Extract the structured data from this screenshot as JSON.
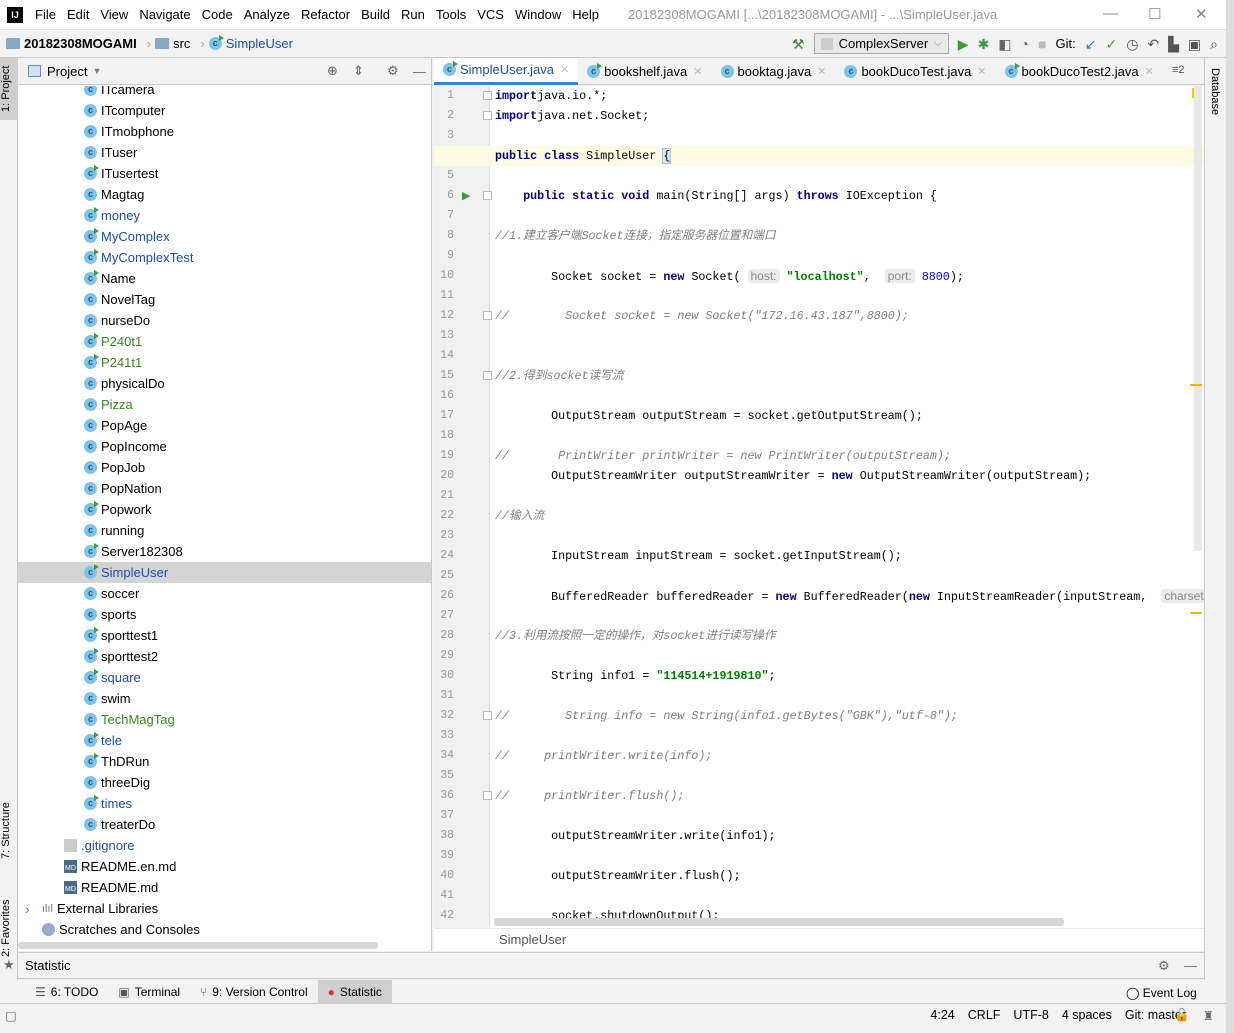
{
  "menubar": {
    "items": [
      "File",
      "Edit",
      "View",
      "Navigate",
      "Code",
      "Analyze",
      "Refactor",
      "Build",
      "Run",
      "Tools",
      "VCS",
      "Window",
      "Help"
    ],
    "window_title": "20182308MOGAMI [...\\20182308MOGAMI] - ...\\SimpleUser.java"
  },
  "navbar": {
    "crumbs": [
      "20182308MOGAMI",
      "src",
      "SimpleUser"
    ],
    "run_config": "ComplexServer",
    "git_label": "Git:"
  },
  "left_strip": {
    "project": "1: Project",
    "structure": "7: Structure",
    "favorites": "2: Favorites"
  },
  "right_strip": {
    "database": "Database"
  },
  "project": {
    "title": "Project",
    "tree": [
      {
        "label": "ITcamera",
        "kind": "class",
        "status": "",
        "run": false,
        "indent": 1
      },
      {
        "label": "ITcomputer",
        "kind": "class",
        "status": "",
        "run": false,
        "indent": 1
      },
      {
        "label": "ITmobphone",
        "kind": "class",
        "status": "",
        "run": false,
        "indent": 1
      },
      {
        "label": "ITuser",
        "kind": "class",
        "status": "",
        "run": false,
        "indent": 1
      },
      {
        "label": "ITusertest",
        "kind": "class",
        "status": "",
        "run": true,
        "indent": 1
      },
      {
        "label": "Magtag",
        "kind": "class",
        "status": "",
        "run": false,
        "indent": 1
      },
      {
        "label": "money",
        "kind": "class",
        "status": "mod",
        "run": true,
        "indent": 1
      },
      {
        "label": "MyComplex",
        "kind": "class",
        "status": "mod",
        "run": true,
        "indent": 1
      },
      {
        "label": "MyComplexTest",
        "kind": "class",
        "status": "mod",
        "run": true,
        "indent": 1
      },
      {
        "label": "Name",
        "kind": "class",
        "status": "",
        "run": true,
        "indent": 1
      },
      {
        "label": "NovelTag",
        "kind": "class",
        "status": "",
        "run": false,
        "indent": 1
      },
      {
        "label": "nurseDo",
        "kind": "class",
        "status": "",
        "run": false,
        "indent": 1
      },
      {
        "label": "P240t1",
        "kind": "class",
        "status": "new",
        "run": true,
        "indent": 1
      },
      {
        "label": "P241t1",
        "kind": "class",
        "status": "new",
        "run": true,
        "indent": 1
      },
      {
        "label": "physicalDo",
        "kind": "class",
        "status": "",
        "run": false,
        "indent": 1
      },
      {
        "label": "Pizza",
        "kind": "class",
        "status": "new",
        "run": false,
        "indent": 1
      },
      {
        "label": "PopAge",
        "kind": "class",
        "status": "",
        "run": false,
        "indent": 1
      },
      {
        "label": "PopIncome",
        "kind": "class",
        "status": "",
        "run": false,
        "indent": 1
      },
      {
        "label": "PopJob",
        "kind": "class",
        "status": "",
        "run": false,
        "indent": 1
      },
      {
        "label": "PopNation",
        "kind": "class",
        "status": "",
        "run": false,
        "indent": 1
      },
      {
        "label": "Popwork",
        "kind": "class",
        "status": "",
        "run": true,
        "indent": 1
      },
      {
        "label": "running",
        "kind": "class",
        "status": "",
        "run": false,
        "indent": 1
      },
      {
        "label": "Server182308",
        "kind": "class",
        "status": "",
        "run": true,
        "indent": 1
      },
      {
        "label": "SimpleUser",
        "kind": "class",
        "status": "mod",
        "run": true,
        "indent": 1,
        "selected": true
      },
      {
        "label": "soccer",
        "kind": "class",
        "status": "",
        "run": false,
        "indent": 1
      },
      {
        "label": "sports",
        "kind": "class",
        "status": "",
        "run": false,
        "indent": 1
      },
      {
        "label": "sporttest1",
        "kind": "class",
        "status": "",
        "run": true,
        "indent": 1
      },
      {
        "label": "sporttest2",
        "kind": "class",
        "status": "",
        "run": true,
        "indent": 1
      },
      {
        "label": "square",
        "kind": "class",
        "status": "mod",
        "run": true,
        "indent": 1
      },
      {
        "label": "swim",
        "kind": "class",
        "status": "",
        "run": false,
        "indent": 1
      },
      {
        "label": "TechMagTag",
        "kind": "class",
        "status": "new",
        "run": false,
        "indent": 1
      },
      {
        "label": "tele",
        "kind": "class",
        "status": "mod",
        "run": true,
        "indent": 1
      },
      {
        "label": "ThDRun",
        "kind": "class",
        "status": "",
        "run": true,
        "indent": 1
      },
      {
        "label": "threeDig",
        "kind": "class",
        "status": "",
        "run": false,
        "indent": 1
      },
      {
        "label": "times",
        "kind": "class",
        "status": "mod",
        "run": true,
        "indent": 1
      },
      {
        "label": "treaterDo",
        "kind": "class",
        "status": "",
        "run": false,
        "indent": 1
      },
      {
        "label": ".gitignore",
        "kind": "file",
        "status": "mod",
        "run": false,
        "indent": 0
      },
      {
        "label": "README.en.md",
        "kind": "md",
        "status": "",
        "run": false,
        "indent": 0
      },
      {
        "label": "README.md",
        "kind": "md",
        "status": "",
        "run": false,
        "indent": 0
      },
      {
        "label": "External Libraries",
        "kind": "lib",
        "status": "",
        "run": false,
        "indent": -1
      },
      {
        "label": "Scratches and Consoles",
        "kind": "scratch",
        "status": "",
        "run": false,
        "indent": -1
      }
    ]
  },
  "editor": {
    "tabs": [
      {
        "label": "SimpleUser.java",
        "active": true
      },
      {
        "label": "bookshelf.java"
      },
      {
        "label": "booktag.java"
      },
      {
        "label": "bookDucoTest.java"
      },
      {
        "label": "bookDucoTest2.java"
      }
    ],
    "tab_overflow": "≡2",
    "current_line": 4,
    "lines": [
      [
        [
          "kw",
          "import"
        ],
        [
          "",
          "java.io.*;"
        ]
      ],
      [
        [
          "kw",
          "import"
        ],
        [
          "",
          "java.net.Socket;"
        ]
      ],
      [],
      [
        [
          "kw",
          "public class"
        ],
        [
          "",
          " SimpleUser "
        ],
        [
          "brace",
          "{"
        ]
      ],
      [],
      [
        [
          "",
          "    "
        ],
        [
          "kw",
          "public static void"
        ],
        [
          "",
          " main(String[] args) "
        ],
        [
          "kw",
          "throws"
        ],
        [
          "",
          " IOException {"
        ]
      ],
      [],
      [
        [
          "cmt",
          "//1.建立客户端Socket连接，指定服务器位置和端口"
        ]
      ],
      [],
      [
        [
          "",
          "        Socket socket = "
        ],
        [
          "kw",
          "new"
        ],
        [
          "",
          " Socket( "
        ],
        [
          "hint",
          "host:"
        ],
        [
          "",
          " "
        ],
        [
          "str",
          "\"localhost\""
        ],
        [
          "",
          ",  "
        ],
        [
          "hint",
          "port:"
        ],
        [
          "",
          " "
        ],
        [
          "num",
          "8800"
        ],
        [
          "",
          ");"
        ]
      ],
      [],
      [
        [
          "cmt",
          "//        Socket socket = new Socket(\"172.16.43.187\",8800);"
        ]
      ],
      [],
      [],
      [
        [
          "cmt",
          "//2.得到socket读写流"
        ]
      ],
      [],
      [
        [
          "",
          "        OutputStream outputStream = socket.getOutputStream();"
        ]
      ],
      [],
      [
        [
          "cmt",
          "//       PrintWriter printWriter = new PrintWriter(outputStream);"
        ]
      ],
      [
        [
          "",
          "        OutputStreamWriter outputStreamWriter = "
        ],
        [
          "kw",
          "new"
        ],
        [
          "",
          " OutputStreamWriter(outputStream);"
        ]
      ],
      [],
      [
        [
          "cmt",
          "//输入流"
        ]
      ],
      [],
      [
        [
          "",
          "        InputStream inputStream = socket.getInputStream();"
        ]
      ],
      [],
      [
        [
          "",
          "        BufferedReader bufferedReader = "
        ],
        [
          "kw",
          "new"
        ],
        [
          "",
          " BufferedReader("
        ],
        [
          "kw",
          "new"
        ],
        [
          "",
          " InputStreamReader(inputStream,  "
        ],
        [
          "hint",
          "charset:"
        ]
      ],
      [],
      [
        [
          "cmt",
          "//3.利用流按照一定的操作，对socket进行读写操作"
        ]
      ],
      [],
      [
        [
          "",
          "        String info1 = "
        ],
        [
          "str",
          "\"114514+1919810\""
        ],
        [
          "",
          ";"
        ]
      ],
      [],
      [
        [
          "cmt",
          "//        String info = new String(info1.getBytes(\"GBK\"),\"utf-8\");"
        ]
      ],
      [],
      [
        [
          "cmt",
          "//     printWriter.write(info);"
        ]
      ],
      [],
      [
        [
          "cmt",
          "//     printWriter.flush();"
        ]
      ],
      [],
      [
        [
          "",
          "        outputStreamWriter.write(info1);"
        ]
      ],
      [],
      [
        [
          "",
          "        outputStreamWriter.flush();"
        ]
      ],
      [],
      [
        [
          "",
          "        socket.shutdownOutput();"
        ]
      ]
    ],
    "breadcrumb": "SimpleUser"
  },
  "statistic_panel": {
    "title": "Statistic"
  },
  "bottom_tabs": [
    {
      "label": "6: TODO",
      "icon": "list-icon"
    },
    {
      "label": "Terminal",
      "icon": "terminal-icon"
    },
    {
      "label": "9: Version Control",
      "icon": "vcs-icon"
    },
    {
      "label": "Statistic",
      "icon": "statistic-icon",
      "active": true
    }
  ],
  "event_log": "Event Log",
  "status": {
    "position": "4:24",
    "line_sep": "CRLF",
    "encoding": "UTF-8",
    "indent": "4 spaces",
    "git": "Git: master"
  }
}
